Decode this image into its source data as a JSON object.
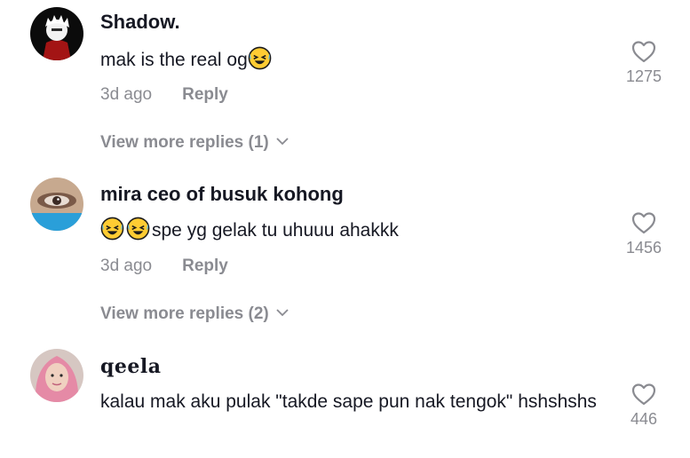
{
  "comments": [
    {
      "username": "Shadow.",
      "text": "mak is the real og",
      "emojis_before": 0,
      "emojis_after": 1,
      "time": "3d ago",
      "reply_label": "Reply",
      "likes": "1275",
      "view_more": "View more replies (1)",
      "emoji_icon": "rolling-on-floor-laughing-emoji"
    },
    {
      "username": "mira ceo of busuk kohong",
      "text": "spe yg gelak tu uhuuu ahakkk",
      "emojis_before": 2,
      "emojis_after": 0,
      "time": "3d ago",
      "reply_label": "Reply",
      "likes": "1456",
      "view_more": "View more replies (2)",
      "emoji_icon": "rolling-on-floor-laughing-emoji"
    },
    {
      "username": "𝐪𝐞𝐞𝐥𝐚",
      "text": "kalau mak aku pulak \"takde sape pun nak tengok\" hshshshs",
      "time": "",
      "reply_label": "",
      "likes": "446"
    }
  ],
  "icons": {
    "like": "heart-outline-icon",
    "expand": "chevron-down-icon"
  },
  "colors": {
    "text": "#161823",
    "secondary": "#8a8b91",
    "emoji_face": "#ffcc33"
  }
}
